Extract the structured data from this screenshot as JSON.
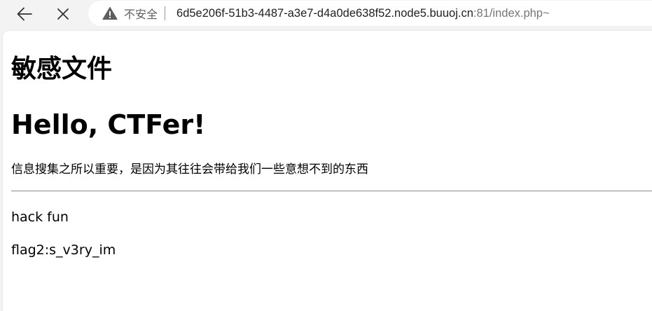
{
  "browser": {
    "security_label": "不安全",
    "url_host": "6d5e206f-51b3-4487-a3e7-d4a0de638f52.node5.buuoj.cn",
    "url_rest": ":81/index.php~"
  },
  "page": {
    "heading_sensitive": "敏感文件",
    "heading_hello": "Hello, CTFer!",
    "info_text": "信息搜集之所以重要，是因为其往往会带给我们一些意想不到的东西",
    "hack_text": "hack fun",
    "flag_text": "flag2:s_v3ry_im"
  }
}
